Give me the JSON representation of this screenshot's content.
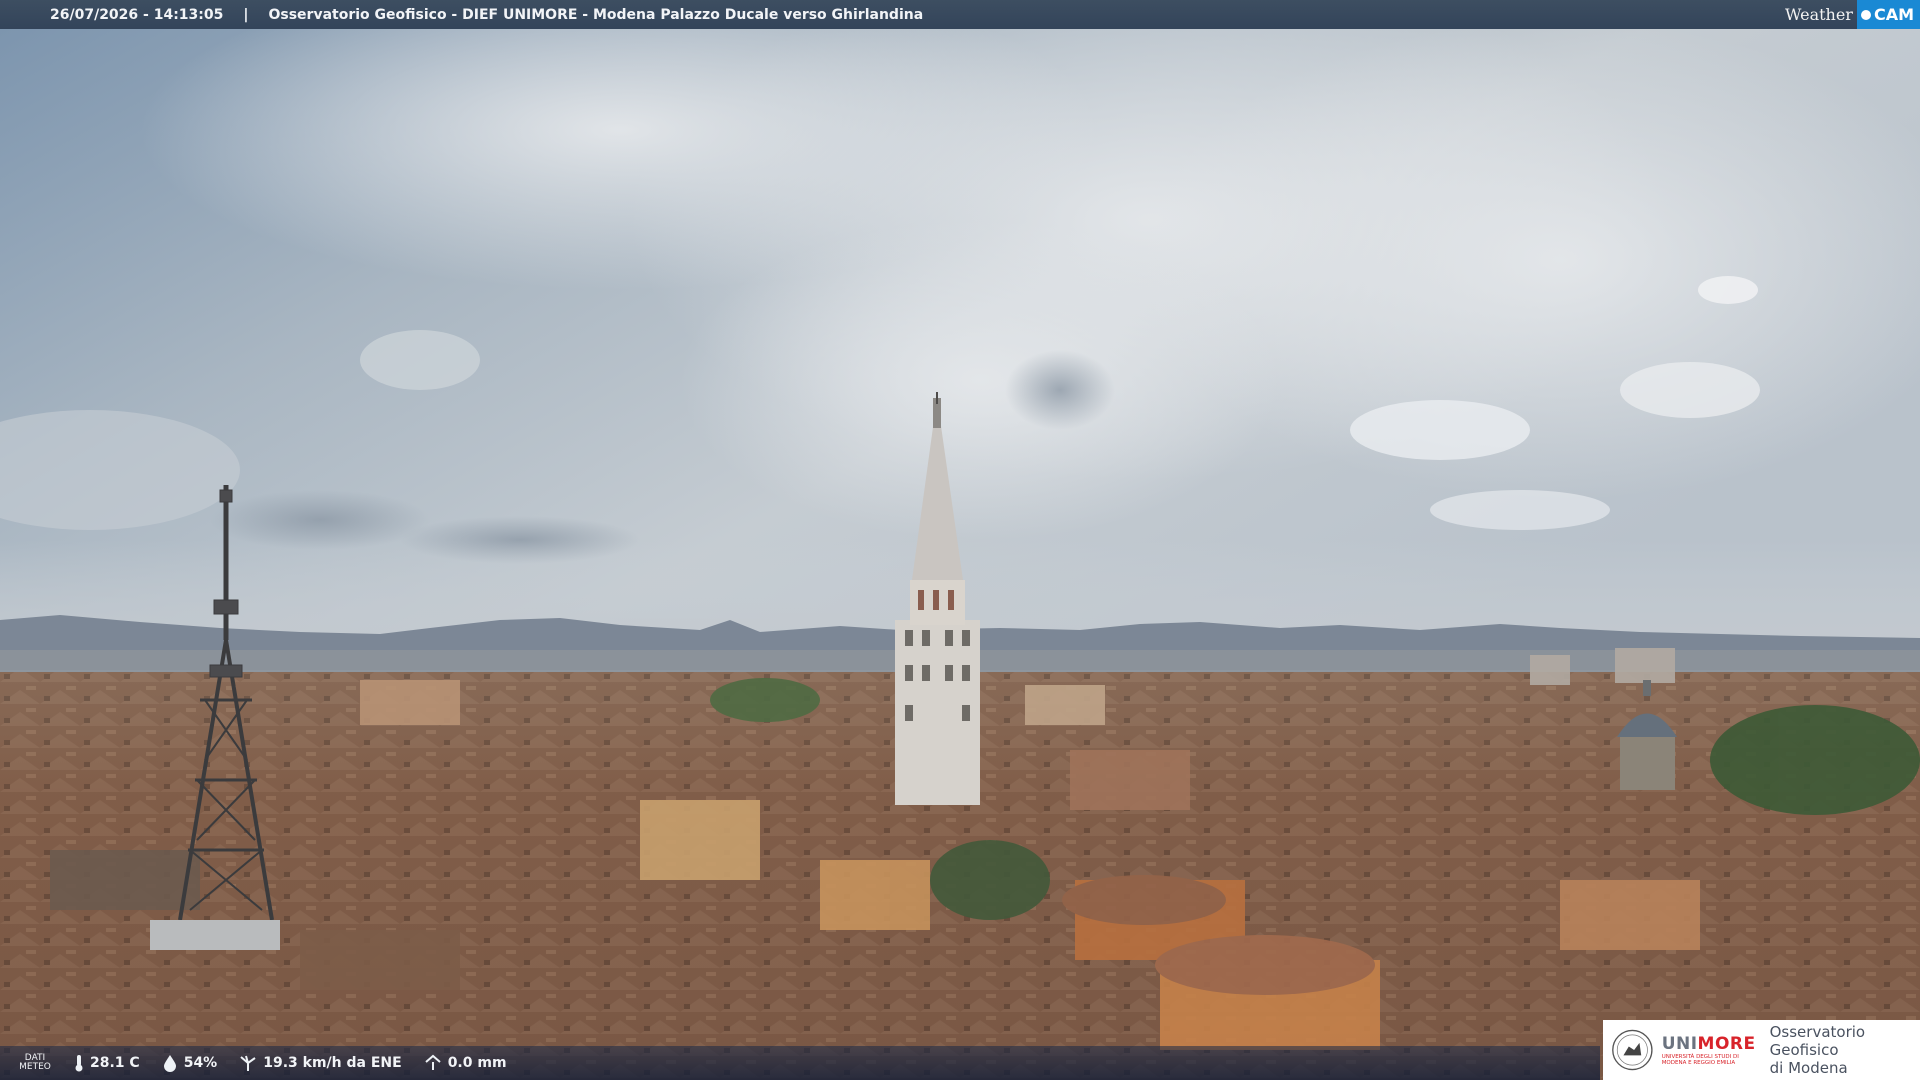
{
  "header": {
    "timestamp": "26/07/2026 - 14:13:05",
    "separator": "|",
    "title": "Osservatorio Geofisico - DIEF UNIMORE - Modena Palazzo Ducale verso Ghirlandina"
  },
  "brand": {
    "weather": "Weather",
    "cam": "CAM"
  },
  "meteo": {
    "label_line1": "DATI",
    "label_line2": "METEO",
    "temperature": "28.1 C",
    "humidity": "54%",
    "wind": "19.3 km/h da ENE",
    "rain": "0.0 mm"
  },
  "logo": {
    "uni_a": "UNI",
    "uni_b": "MORE",
    "uni_sub1": "UNIVERSITÀ DEGLI STUDI DI",
    "uni_sub2": "MODENA E REGGIO EMILIA",
    "observatory_line1": "Osservatorio Geofisico",
    "observatory_line2": "di Modena"
  },
  "colors": {
    "header_bg": "#3d4e61",
    "cam_accent": "#1a89d4",
    "unimore_red": "#d8232a"
  }
}
